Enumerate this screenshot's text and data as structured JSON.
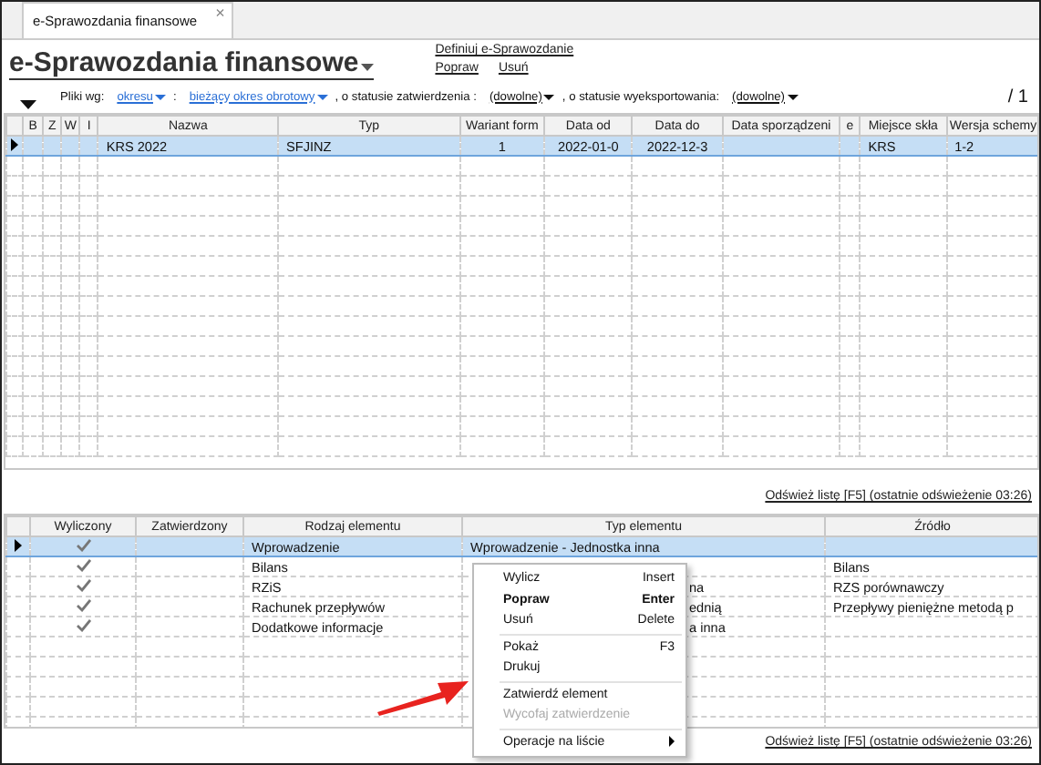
{
  "tab": {
    "label": "e-Sprawozdania finansowe",
    "close": "×"
  },
  "header": {
    "title": "e-Sprawozdania finansowe",
    "links": [
      "Definiuj e-Sprawozdanie",
      "Popraw",
      "Usuń"
    ]
  },
  "filters": {
    "label": "Pliki wg:",
    "period_by": "okresu",
    "separator": ":",
    "period": "bieżący okres obrotowy",
    "approval_label": ", o statusie zatwierdzenia :",
    "approval": "(dowolne)",
    "export_label": ", o statusie wyeksportowania:",
    "export": "(dowolne)",
    "page": "/ 1"
  },
  "files_table": {
    "columns": [
      "B",
      "Z",
      "W",
      "I",
      "Nazwa",
      "Typ",
      "Wariant form",
      "Data od",
      "Data do",
      "Data sporządzeni",
      "e",
      "Miejsce skła",
      "Wersja schemy"
    ],
    "rows": [
      {
        "selected": true,
        "cells": [
          "",
          "",
          "",
          "",
          "KRS 2022",
          "SFJINZ",
          "1",
          "2022-01-0",
          "2022-12-3",
          "",
          "",
          "KRS",
          "1-2"
        ]
      }
    ]
  },
  "refresh": "Odśwież listę [F5] (ostatnie odświeżenie 03:26)",
  "elements_table": {
    "columns": [
      "Wyliczony",
      "Zatwierdzony",
      "Rodzaj elementu",
      "Typ elementu",
      "Źródło"
    ],
    "rows": [
      {
        "selected": true,
        "computed": true,
        "approved": false,
        "kind": "Wprowadzenie",
        "type": "Wprowadzenie - Jednostka inna",
        "covered": false,
        "source": ""
      },
      {
        "selected": false,
        "computed": true,
        "approved": false,
        "kind": "Bilans",
        "type": "",
        "covered": true,
        "source": "Bilans"
      },
      {
        "selected": false,
        "computed": true,
        "approved": false,
        "kind": "RZiS",
        "type": "na",
        "covered": true,
        "source": "RZS porównawczy"
      },
      {
        "selected": false,
        "computed": true,
        "approved": false,
        "kind": "Rachunek przepływów",
        "type": "ednią",
        "covered": true,
        "source": "Przepływy pieniężne metodą p"
      },
      {
        "selected": false,
        "computed": true,
        "approved": false,
        "kind": "Dodatkowe informacje",
        "type": "a inna",
        "covered": true,
        "source": ""
      }
    ]
  },
  "context_menu": [
    {
      "kind": "item",
      "label": "Wylicz",
      "shortcut": "Insert",
      "default": false,
      "disabled": false
    },
    {
      "kind": "item",
      "label": "Popraw",
      "shortcut": "Enter",
      "default": true,
      "disabled": false
    },
    {
      "kind": "item",
      "label": "Usuń",
      "shortcut": "Delete",
      "default": false,
      "disabled": false
    },
    {
      "kind": "separator"
    },
    {
      "kind": "item",
      "label": "Pokaż",
      "shortcut": "F3",
      "default": false,
      "disabled": false
    },
    {
      "kind": "item",
      "label": "Drukuj",
      "default": false,
      "disabled": false
    },
    {
      "kind": "separator"
    },
    {
      "kind": "item",
      "label": "Zatwierdź element",
      "default": false,
      "disabled": false
    },
    {
      "kind": "item",
      "label": "Wycofaj zatwierdzenie",
      "default": false,
      "disabled": true
    },
    {
      "kind": "separator"
    },
    {
      "kind": "submenu",
      "label": "Operacje na liście",
      "default": false,
      "disabled": false
    }
  ],
  "refresh_bottom": "Odśwież listę [F5] (ostatnie odświeżenie 03:26)"
}
